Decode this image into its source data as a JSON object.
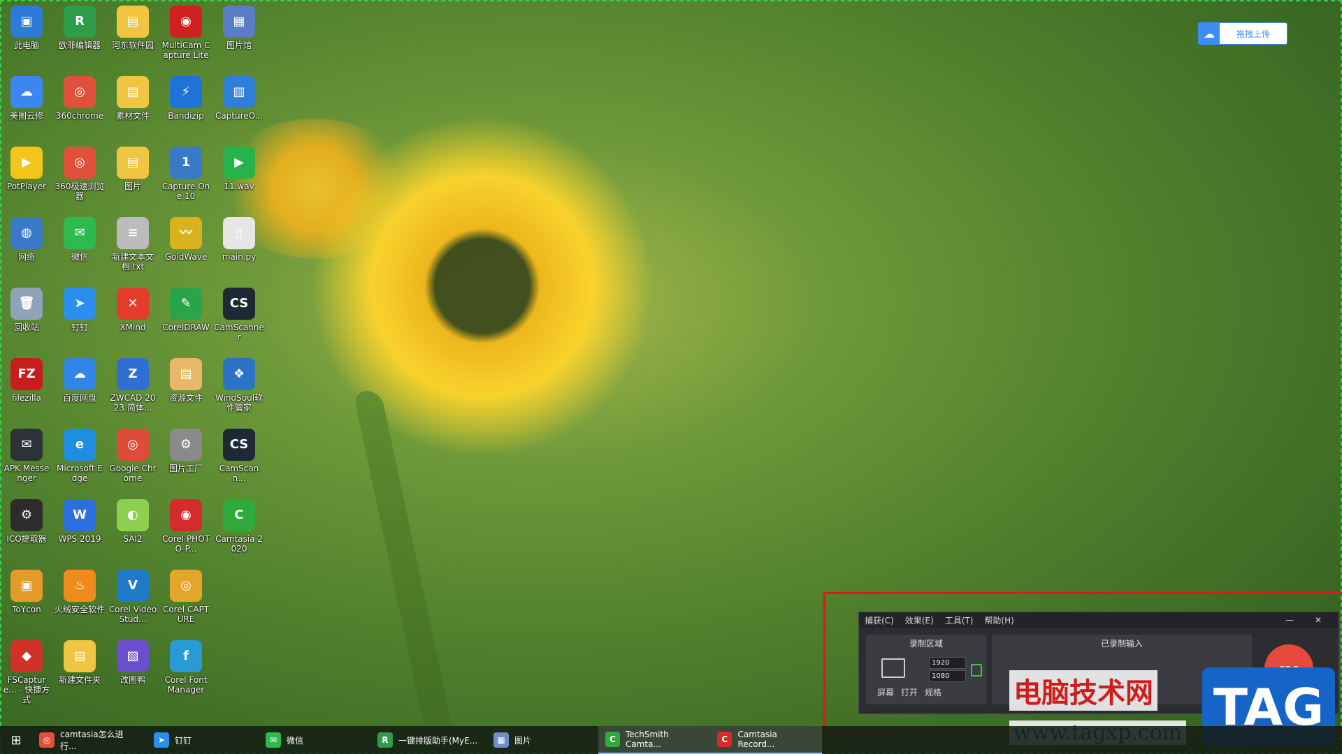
{
  "desktop": {
    "icons": [
      {
        "label": "此电脑",
        "color": "#2d7bd6",
        "glyph": "▣"
      },
      {
        "label": "欧菲编辑器",
        "color": "#2f9c4a",
        "glyph": "R"
      },
      {
        "label": "河东软件园",
        "color": "#f0c542",
        "glyph": "▤"
      },
      {
        "label": "MultiCam Capture Lite",
        "color": "#d02020",
        "glyph": "◉"
      },
      {
        "label": "图片馆",
        "color": "#5a7dc5",
        "glyph": "▦"
      },
      {
        "label": "美图云修",
        "color": "#3d86f0",
        "glyph": "☁"
      },
      {
        "label": "360chrome",
        "color": "#e0503a",
        "glyph": "◎"
      },
      {
        "label": "素材文件",
        "color": "#f0c542",
        "glyph": "▤"
      },
      {
        "label": "Bandizip",
        "color": "#1d74d6",
        "glyph": "⚡"
      },
      {
        "label": "CaptureO...",
        "color": "#2f7fd8",
        "glyph": "▥"
      },
      {
        "label": "PotPlayer",
        "color": "#f3c51a",
        "glyph": "▶"
      },
      {
        "label": "360极速浏览器",
        "color": "#e0503a",
        "glyph": "◎"
      },
      {
        "label": "图片",
        "color": "#f0c542",
        "glyph": "▤"
      },
      {
        "label": "Capture One 10",
        "color": "#3a78c8",
        "glyph": "1"
      },
      {
        "label": "11.wav",
        "color": "#26b34a",
        "glyph": "▶"
      },
      {
        "label": "网络",
        "color": "#3a78c8",
        "glyph": "◍"
      },
      {
        "label": "微信",
        "color": "#2dbb4f",
        "glyph": "✉"
      },
      {
        "label": "新建文本文档.txt",
        "color": "#bcbcbc",
        "glyph": "≡"
      },
      {
        "label": "GoldWave",
        "color": "#d8b21c",
        "glyph": "〰"
      },
      {
        "label": "main.py",
        "color": "#e6e6e6",
        "glyph": "▯"
      },
      {
        "label": "回收站",
        "color": "#8fa3b8",
        "glyph": "🗑"
      },
      {
        "label": "钉钉",
        "color": "#2b8ff0",
        "glyph": "➤"
      },
      {
        "label": "XMind",
        "color": "#e43b2c",
        "glyph": "✕"
      },
      {
        "label": "CorelDRAW",
        "color": "#2aa44a",
        "glyph": "✎"
      },
      {
        "label": "CamScanner",
        "color": "#1d2a36",
        "glyph": "CS"
      },
      {
        "label": "filezilla",
        "color": "#c81d1d",
        "glyph": "FZ"
      },
      {
        "label": "百度网盘",
        "color": "#2f86e8",
        "glyph": "☁"
      },
      {
        "label": "ZWCAD 2023 简体...",
        "color": "#2f6fd1",
        "glyph": "Z"
      },
      {
        "label": "资源文件",
        "color": "#e8b86a",
        "glyph": "▤"
      },
      {
        "label": "WindSoul软件管家",
        "color": "#2a73c6",
        "glyph": "❖"
      },
      {
        "label": "APK Messenger",
        "color": "#2b3238",
        "glyph": "✉"
      },
      {
        "label": "Microsoft Edge",
        "color": "#1f8de0",
        "glyph": "e"
      },
      {
        "label": "Google Chrome",
        "color": "#dd4b39",
        "glyph": "◎"
      },
      {
        "label": "图片工厂",
        "color": "#8a8a8a",
        "glyph": "⚙"
      },
      {
        "label": "CamScann...",
        "color": "#1d2a36",
        "glyph": "CS"
      },
      {
        "label": "ICO提取器",
        "color": "#2c2c2c",
        "glyph": "⚙"
      },
      {
        "label": "WPS 2019",
        "color": "#2d6fe0",
        "glyph": "W"
      },
      {
        "label": "SAI2",
        "color": "#8fcf4f",
        "glyph": "◐"
      },
      {
        "label": "Corel PHOTO-P...",
        "color": "#d42b2b",
        "glyph": "◉"
      },
      {
        "label": "Camtasia 2020",
        "color": "#2faa3d",
        "glyph": "C"
      },
      {
        "label": "ToYcon",
        "color": "#e39a2a",
        "glyph": "▣"
      },
      {
        "label": "火绒安全软件",
        "color": "#f08a1c",
        "glyph": "♨"
      },
      {
        "label": "Corel VideoStud...",
        "color": "#1f7bc8",
        "glyph": "V"
      },
      {
        "label": "Corel CAPTURE",
        "color": "#e3a52a",
        "glyph": "◎"
      },
      {
        "label": "FSCapture... - 快捷方式",
        "color": "#d0322a",
        "glyph": "◆"
      },
      {
        "label": "新建文件夹",
        "color": "#f0c542",
        "glyph": "▤"
      },
      {
        "label": "改图鸭",
        "color": "#6b4fcf",
        "glyph": "▧"
      },
      {
        "label": "Corel Font Manager",
        "color": "#2a9ad6",
        "glyph": "f"
      }
    ]
  },
  "upload_button": {
    "label": "拖拽上传",
    "icon": "cloud-icon"
  },
  "recorder": {
    "menu": [
      "捕获(C)",
      "效果(E)",
      "工具(T)",
      "帮助(H)"
    ],
    "area_title": "录制区域",
    "width": "1920",
    "height": "1080",
    "area_labels": [
      "屏幕",
      "打开",
      "规格"
    ],
    "input_title": "已录制输入",
    "rec_label": "rec"
  },
  "watermark": {
    "cn": "电脑技术网",
    "url": "www.tagxp.com",
    "tag": "TAG"
  },
  "taskbar": {
    "items": [
      {
        "label": "camtasia怎么进行...",
        "color": "#e0503a",
        "glyph": "◎",
        "active": false
      },
      {
        "label": "钉钉",
        "color": "#2b8ff0",
        "glyph": "➤",
        "active": false
      },
      {
        "label": "微信",
        "color": "#2dbb4f",
        "glyph": "✉",
        "active": false
      },
      {
        "label": "一键排版助手(MyE...",
        "color": "#2f9c4a",
        "glyph": "R",
        "active": false
      },
      {
        "label": "图片",
        "color": "#6f8ec6",
        "glyph": "▦",
        "active": false
      },
      {
        "label": "TechSmith Camta...",
        "color": "#2faa3d",
        "glyph": "C",
        "active": true
      },
      {
        "label": "Camtasia Record...",
        "color": "#d42b2b",
        "glyph": "C",
        "active": true
      }
    ]
  }
}
